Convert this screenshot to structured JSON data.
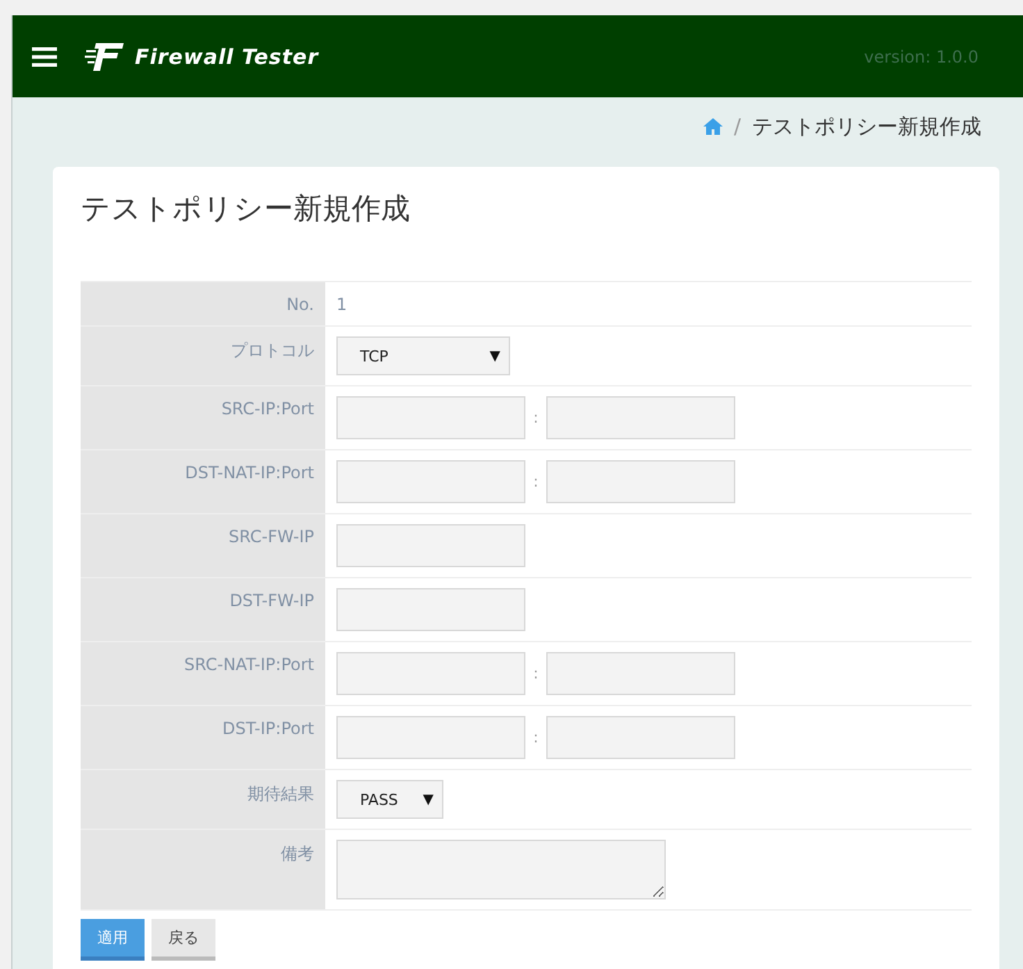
{
  "header": {
    "app_name": "Firewall Tester",
    "version": "version: 1.0.0"
  },
  "breadcrumb": {
    "separator": "/",
    "current": "テストポリシー新規作成"
  },
  "card": {
    "title": "テストポリシー新規作成"
  },
  "form_rows": [
    {
      "kind": "text",
      "label": "No.",
      "value": "1"
    },
    {
      "kind": "select",
      "label": "プロトコル",
      "value": "TCP",
      "caret": "▼"
    },
    {
      "kind": "pair",
      "label": "SRC-IP:Port",
      "separator": ":"
    },
    {
      "kind": "pair",
      "label": "DST-NAT-IP:Port",
      "separator": ":"
    },
    {
      "kind": "single",
      "label": "SRC-FW-IP"
    },
    {
      "kind": "single",
      "label": "DST-FW-IP"
    },
    {
      "kind": "pair",
      "label": "SRC-NAT-IP:Port",
      "separator": ":"
    },
    {
      "kind": "pair",
      "label": "DST-IP:Port",
      "separator": ":"
    },
    {
      "kind": "select",
      "label": "期待結果",
      "value": "PASS",
      "caret": "▼"
    },
    {
      "kind": "textarea",
      "label": "備考"
    }
  ],
  "buttons": [
    {
      "label": "適用",
      "kind": "primary"
    },
    {
      "label": "戻る",
      "kind": "default"
    }
  ]
}
